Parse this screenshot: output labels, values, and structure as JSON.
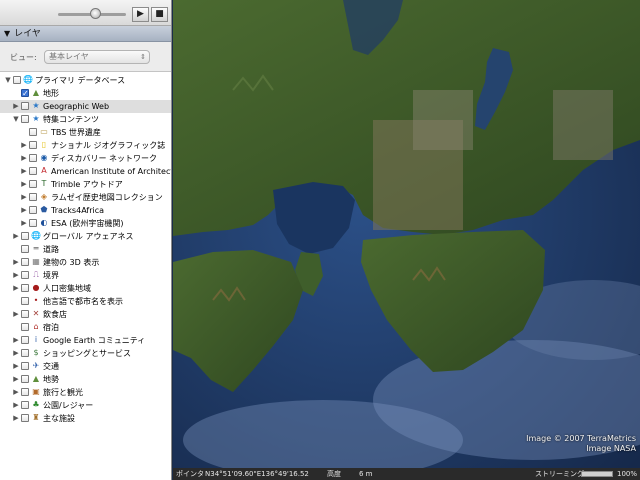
{
  "sidebar": {
    "panel_title": "レイヤ",
    "view_label": "ビュー:",
    "view_value": "基本レイヤ",
    "layers": [
      {
        "label": "プライマリ データベース",
        "level": 0,
        "disc": "open",
        "checked": false,
        "icon": "globe-icon"
      },
      {
        "label": "地形",
        "level": 1,
        "disc": "none",
        "checked": true,
        "icon": "terrain-icon"
      },
      {
        "label": "Geographic Web",
        "level": 1,
        "disc": "closed",
        "checked": false,
        "icon": "star-icon",
        "selected": true
      },
      {
        "label": "特集コンテンツ",
        "level": 1,
        "disc": "open",
        "checked": false,
        "icon": "star-icon"
      },
      {
        "label": "TBS 世界遺産",
        "level": 2,
        "disc": "none",
        "checked": false,
        "icon": "folder-icon"
      },
      {
        "label": "ナショナル ジオグラフィック誌",
        "level": 2,
        "disc": "closed",
        "checked": false,
        "icon": "natgeo-icon"
      },
      {
        "label": "ディスカバリー ネットワーク",
        "level": 2,
        "disc": "closed",
        "checked": false,
        "icon": "discovery-icon"
      },
      {
        "label": "American Institute of Architects",
        "level": 2,
        "disc": "closed",
        "checked": false,
        "icon": "aia-icon"
      },
      {
        "label": "Trimble アウトドア",
        "level": 2,
        "disc": "closed",
        "checked": false,
        "icon": "trimble-icon"
      },
      {
        "label": "ラムゼイ歴史地図コレクション",
        "level": 2,
        "disc": "closed",
        "checked": false,
        "icon": "map-collection-icon"
      },
      {
        "label": "Tracks4Africa",
        "level": 2,
        "disc": "closed",
        "checked": false,
        "icon": "tracks-icon"
      },
      {
        "label": "ESA (欧州宇宙機関)",
        "level": 2,
        "disc": "closed",
        "checked": false,
        "icon": "esa-icon"
      },
      {
        "label": "グローバル アウェアネス",
        "level": 1,
        "disc": "closed",
        "checked": false,
        "icon": "globe-icon"
      },
      {
        "label": "道路",
        "level": 1,
        "disc": "none",
        "checked": false,
        "icon": "road-icon"
      },
      {
        "label": "建物の 3D 表示",
        "level": 1,
        "disc": "closed",
        "checked": false,
        "icon": "building-icon"
      },
      {
        "label": "境界",
        "level": 1,
        "disc": "closed",
        "checked": false,
        "icon": "border-icon"
      },
      {
        "label": "人口密集地域",
        "level": 1,
        "disc": "closed",
        "checked": false,
        "icon": "population-icon"
      },
      {
        "label": "他言語で都市名を表示",
        "level": 1,
        "disc": "none",
        "checked": false,
        "icon": "dot-icon"
      },
      {
        "label": "飲食店",
        "level": 1,
        "disc": "closed",
        "checked": false,
        "icon": "restaurant-icon"
      },
      {
        "label": "宿泊",
        "level": 1,
        "disc": "none",
        "checked": false,
        "icon": "lodging-icon"
      },
      {
        "label": "Google Earth コミュニティ",
        "level": 1,
        "disc": "closed",
        "checked": false,
        "icon": "info-icon"
      },
      {
        "label": "ショッピングとサービス",
        "level": 1,
        "disc": "closed",
        "checked": false,
        "icon": "shopping-icon"
      },
      {
        "label": "交通",
        "level": 1,
        "disc": "closed",
        "checked": false,
        "icon": "transport-icon"
      },
      {
        "label": "地勢",
        "level": 1,
        "disc": "closed",
        "checked": false,
        "icon": "terrain-icon"
      },
      {
        "label": "旅行と観光",
        "level": 1,
        "disc": "closed",
        "checked": false,
        "icon": "travel-icon"
      },
      {
        "label": "公園/レジャー",
        "level": 1,
        "disc": "closed",
        "checked": false,
        "icon": "park-icon"
      },
      {
        "label": "主な施設",
        "level": 1,
        "disc": "closed",
        "checked": false,
        "icon": "facility-icon"
      }
    ]
  },
  "map": {
    "credit_line1": "Image © 2007 TerraMetrics",
    "credit_line2": "Image NASA"
  },
  "status": {
    "pointer_label": "ポインタ",
    "coordinates": "N34°51'09.60\"E136°49'16.52",
    "elevation_label": "高度",
    "elevation_value": "6 m",
    "streaming_label": "ストリーミング",
    "streaming_percent": "100%",
    "streaming_progress": 1.0
  },
  "colors": {
    "ocean": "#1e3a6b",
    "land": "#3f5a2a",
    "selected_row": "#dedede"
  }
}
